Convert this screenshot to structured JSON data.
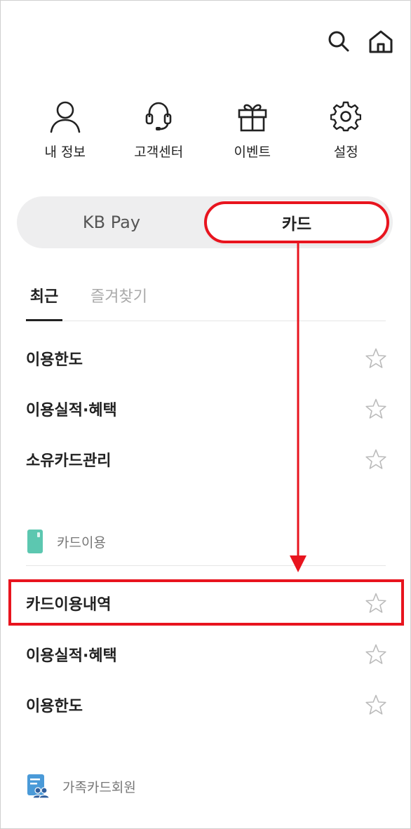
{
  "header": {
    "search_icon": "search-icon",
    "home_icon": "home-icon"
  },
  "quick_menu": [
    {
      "label": "내 정보",
      "icon": "person-icon"
    },
    {
      "label": "고객센터",
      "icon": "headset-icon"
    },
    {
      "label": "이벤트",
      "icon": "gift-icon"
    },
    {
      "label": "설정",
      "icon": "gear-icon"
    }
  ],
  "segment": {
    "kb_pay": "KB Pay",
    "card": "카드",
    "selected": "카드"
  },
  "tabs": {
    "recent": "최근",
    "favorites": "즐겨찾기",
    "active": "최근"
  },
  "recent_items": [
    {
      "label": "이용한도"
    },
    {
      "label": "이용실적·혜택"
    },
    {
      "label": "소유카드관리"
    }
  ],
  "sections": {
    "card_usage": {
      "title": "카드이용",
      "items": [
        {
          "label": "카드이용내역"
        },
        {
          "label": "이용실적·혜택"
        },
        {
          "label": "이용한도"
        }
      ]
    },
    "family_card": {
      "title": "가족카드회원"
    }
  },
  "colors": {
    "highlight": "#e8141e",
    "card_section_icon": "#5cc7b0",
    "family_section_icon": "#4a9ad8"
  }
}
